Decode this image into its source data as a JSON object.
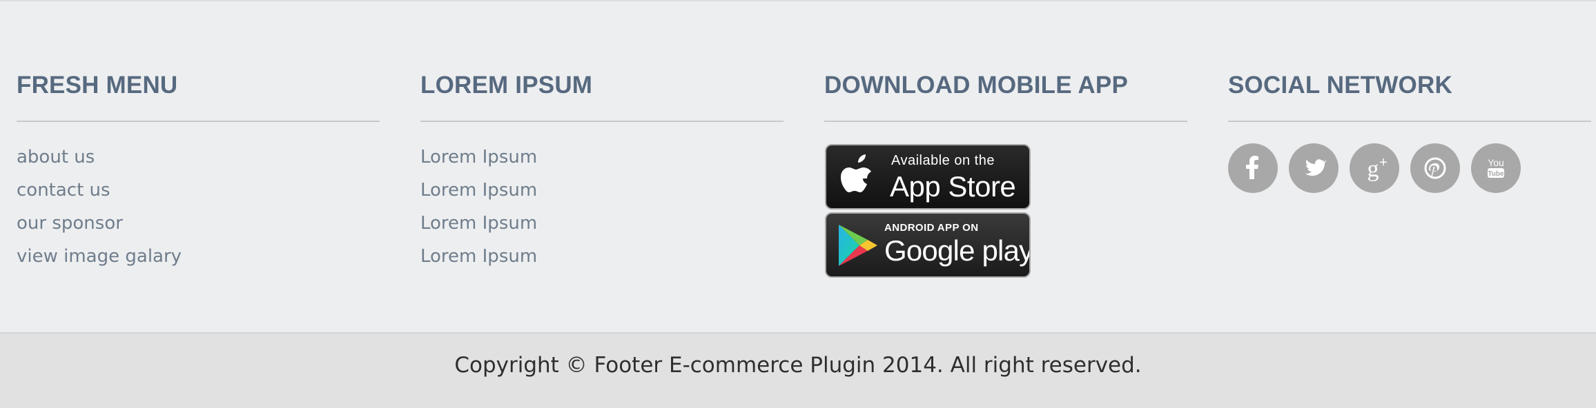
{
  "columns": {
    "fresh_menu": {
      "title": "FRESH MENU",
      "links": [
        "about us",
        "contact us",
        "our sponsor",
        "view image galary"
      ]
    },
    "lorem_ipsum": {
      "title": "LOREM IPSUM",
      "links": [
        "Lorem Ipsum",
        "Lorem Ipsum",
        "Lorem Ipsum",
        "Lorem Ipsum"
      ]
    },
    "mobile_app": {
      "title": "DOWNLOAD MOBILE APP",
      "app_store": {
        "small_text": "Available on the",
        "big_text": "App Store",
        "icon": "apple-icon"
      },
      "google_play": {
        "small_text": "ANDROID APP ON",
        "big_text": "Google play",
        "icon": "google-play-icon"
      }
    },
    "social": {
      "title": "SOCIAL NETWORK",
      "networks": [
        {
          "name": "facebook",
          "icon": "facebook-icon"
        },
        {
          "name": "twitter",
          "icon": "twitter-icon"
        },
        {
          "name": "google-plus",
          "icon": "google-plus-icon"
        },
        {
          "name": "pinterest",
          "icon": "pinterest-icon"
        },
        {
          "name": "youtube",
          "icon": "youtube-icon"
        }
      ]
    }
  },
  "footer": {
    "copyright": "Copyright © Footer E-commerce Plugin 2014. All right reserved."
  },
  "colors": {
    "background": "#edeef0",
    "heading": "#56697f",
    "link": "#6f7d8b",
    "social_button": "#a8a8a8",
    "bottom_bar": "#e1e1e1"
  }
}
